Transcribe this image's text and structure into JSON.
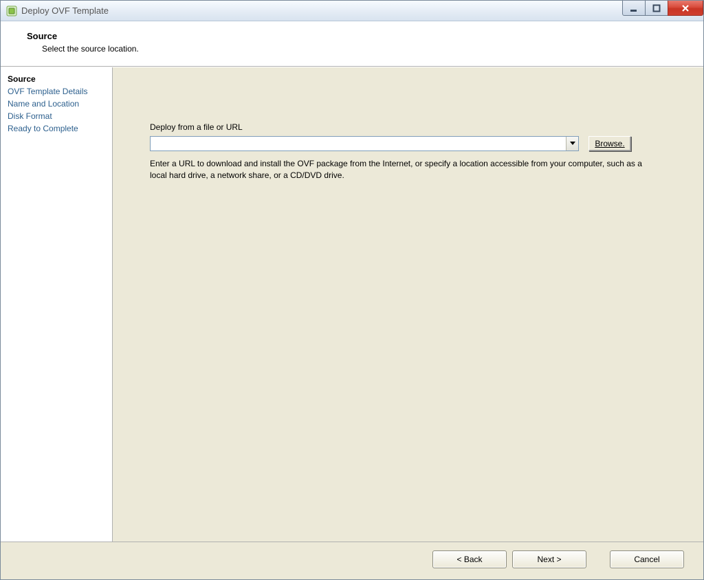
{
  "window": {
    "title": "Deploy OVF Template"
  },
  "header": {
    "title": "Source",
    "subtitle": "Select the source location."
  },
  "sidebar": {
    "steps": [
      {
        "label": "Source",
        "active": true
      },
      {
        "label": "OVF Template Details",
        "active": false
      },
      {
        "label": "Name and Location",
        "active": false
      },
      {
        "label": "Disk Format",
        "active": false
      },
      {
        "label": "Ready to Complete",
        "active": false
      }
    ]
  },
  "main": {
    "field_label": "Deploy from a file or URL",
    "url_value": "",
    "browse_label": "Browse.",
    "help_text": "Enter a URL to download and install the OVF package from the Internet, or specify a location accessible from your computer, such as a local hard drive, a network share, or a CD/DVD drive."
  },
  "footer": {
    "back": "< Back",
    "next": "Next >",
    "cancel": "Cancel"
  }
}
